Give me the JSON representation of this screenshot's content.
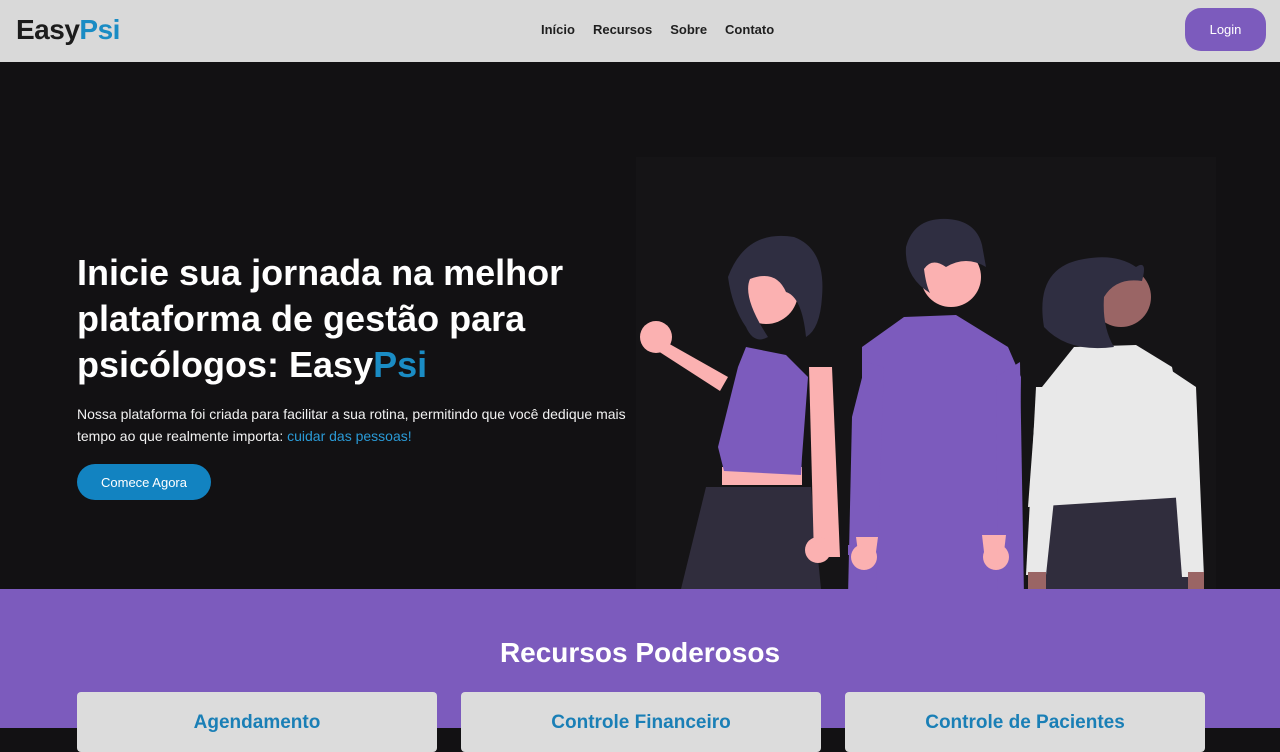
{
  "header": {
    "logo_main": "Easy",
    "logo_accent": "Psi",
    "nav": [
      "Início",
      "Recursos",
      "Sobre",
      "Contato"
    ],
    "login_label": "Login"
  },
  "hero": {
    "title_main": "Inicie sua jornada na melhor plataforma de gestão para psicólogos: Easy",
    "title_accent": "Psi",
    "description": "Nossa plataforma foi criada para facilitar a sua rotina, permitindo que você dedique mais tempo ao que realmente importa: ",
    "description_highlight": "cuidar das pessoas!",
    "cta_label": "Comece Agora"
  },
  "features": {
    "title": "Recursos Poderosos",
    "cards": [
      {
        "title": "Agendamento"
      },
      {
        "title": "Controle Financeiro"
      },
      {
        "title": "Controle de Pacientes"
      }
    ]
  },
  "colors": {
    "brand_purple": "#7c5bbd",
    "brand_blue": "#1a8cc4",
    "header_bg": "#d9d9d9",
    "hero_bg": "#121113"
  }
}
